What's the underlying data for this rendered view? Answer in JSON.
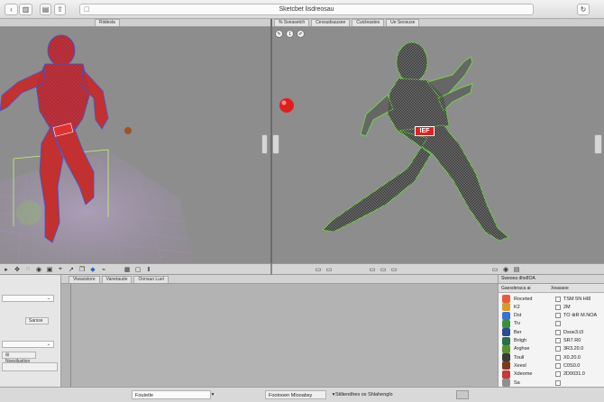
{
  "window": {
    "title": "Sketcbet lisdreosau",
    "back_button": "‹",
    "sidebar_button": "▥",
    "lock_icon": "🔒"
  },
  "left_panel_tabs": [
    "Riidesla"
  ],
  "right_panel_tabs": [
    "% Sveasetch",
    "Cexsudsuusee",
    "Cuicleastes",
    "Ue Seosuse"
  ],
  "viewport_right_tools": [
    "✎",
    "1",
    "✐"
  ],
  "logo_label": "IEF",
  "bottom_tabs": [
    "Viwaostore",
    "Vanetaude",
    "Oonsao Luel"
  ],
  "left_props": {
    "dropdown_1": "",
    "button_1": "Sarsse",
    "dropdown_2": "",
    "button_2": "Noesilustion",
    "button_3": ""
  },
  "properties_panel": {
    "tab_1": "Sweoea dhe8OA",
    "tab_2": "Gaesderaca ai",
    "tab_3": "Xeasaoe",
    "rows": [
      {
        "label": "Roceted",
        "value": "TSM 5N HI8",
        "color": "#e85b3a"
      },
      {
        "label": "K2",
        "value": "2M",
        "color": "#d89b2b"
      },
      {
        "label": "Dst",
        "value": "TO ⊗R M.NOA",
        "color": "#3a6fd6"
      },
      {
        "label": "Tiv",
        "value": "",
        "color": "#3b8f3a"
      },
      {
        "label": "Ber",
        "value": "Dsoe3.t3",
        "color": "#2b4d8f"
      },
      {
        "label": "Briigh",
        "value": "SR7.R0",
        "color": "#2b6e47"
      },
      {
        "label": "Arghse",
        "value": "3R3.20.0",
        "color": "#5c8f2a"
      },
      {
        "label": "Toull",
        "value": "X0.20.0",
        "color": "#3a3a3a"
      },
      {
        "label": "Xeesl",
        "value": "C0S0.0",
        "color": "#7a3a1f"
      },
      {
        "label": "Xdeome",
        "value": "2D0031.0",
        "color": "#c23a3a"
      },
      {
        "label": "Sa",
        "value": "",
        "color": "#8f8f8f"
      }
    ]
  },
  "status_bar": {
    "item_1": "Foutetle",
    "item_2": "",
    "item_3": "Footooen Mlooabsy",
    "item_4": "Stiltendhes os Shlahenglo"
  }
}
